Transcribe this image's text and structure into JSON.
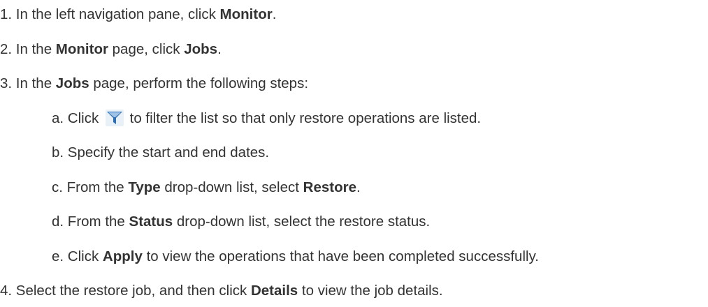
{
  "steps": [
    {
      "num": "1.",
      "parts": [
        {
          "text": " In the left navigation pane, click ",
          "bold": false
        },
        {
          "text": "Monitor",
          "bold": true
        },
        {
          "text": ".",
          "bold": false
        }
      ]
    },
    {
      "num": "2.",
      "parts": [
        {
          "text": " In the ",
          "bold": false
        },
        {
          "text": "Monitor",
          "bold": true
        },
        {
          "text": " page, click ",
          "bold": false
        },
        {
          "text": "Jobs",
          "bold": true
        },
        {
          "text": ".",
          "bold": false
        }
      ]
    },
    {
      "num": "3.",
      "parts": [
        {
          "text": " In the ",
          "bold": false
        },
        {
          "text": "Jobs",
          "bold": true
        },
        {
          "text": " page, perform the following steps:",
          "bold": false
        }
      ],
      "substeps": [
        {
          "num": "a.",
          "before": " Click ",
          "icon": "filter-icon",
          "after": " to filter the list so that only restore operations are listed."
        },
        {
          "num": "b.",
          "parts": [
            {
              "text": " Specify the start and end dates.",
              "bold": false
            }
          ]
        },
        {
          "num": "c.",
          "parts": [
            {
              "text": " From the ",
              "bold": false
            },
            {
              "text": "Type",
              "bold": true
            },
            {
              "text": " drop-down list, select ",
              "bold": false
            },
            {
              "text": "Restore",
              "bold": true
            },
            {
              "text": ".",
              "bold": false
            }
          ]
        },
        {
          "num": "d.",
          "parts": [
            {
              "text": " From the ",
              "bold": false
            },
            {
              "text": "Status",
              "bold": true
            },
            {
              "text": " drop-down list, select the restore status.",
              "bold": false
            }
          ]
        },
        {
          "num": "e.",
          "parts": [
            {
              "text": " Click ",
              "bold": false
            },
            {
              "text": "Apply",
              "bold": true
            },
            {
              "text": " to view the operations that have been completed successfully.",
              "bold": false
            }
          ]
        }
      ]
    },
    {
      "num": "4.",
      "parts": [
        {
          "text": " Select the restore job, and then click ",
          "bold": false
        },
        {
          "text": "Details",
          "bold": true
        },
        {
          "text": " to view the job details.",
          "bold": false
        }
      ]
    }
  ],
  "colors": {
    "text": "#333333",
    "icon_blue": "#2c6fb5",
    "icon_light": "#9fc3e6"
  }
}
